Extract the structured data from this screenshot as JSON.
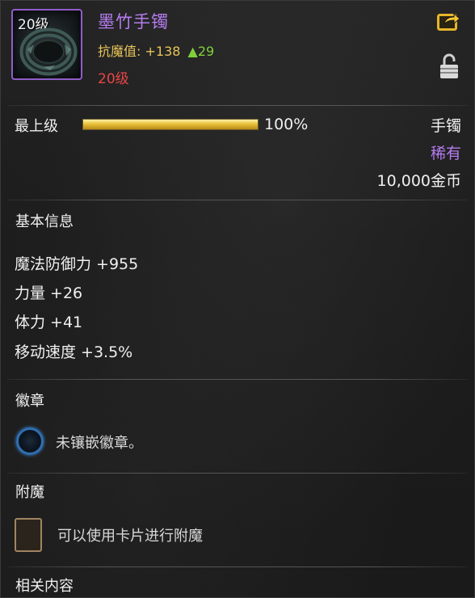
{
  "item": {
    "icon": "bracelet-icon",
    "icon_level": "20级",
    "name": "墨竹手镯",
    "stat_label": "抗魔值:",
    "stat_value": "+138",
    "stat_increase": "▲29",
    "required_level": "20级"
  },
  "header_actions": {
    "share_icon": "share-icon",
    "lock_icon": "lock-icon"
  },
  "grade": {
    "label": "最上级",
    "percent_text": "100%",
    "percent_value": 100
  },
  "meta": {
    "type": "手镯",
    "rarity": "稀有",
    "price": "10,000金币"
  },
  "basic_info": {
    "title": "基本信息",
    "attributes": [
      "魔法防御力 +955",
      "力量 +26",
      "体力 +41",
      "移动速度 +3.5%"
    ]
  },
  "emblem": {
    "title": "徽章",
    "text": "未镶嵌徽章。"
  },
  "enchant": {
    "title": "附魔",
    "text": "可以使用卡片进行附魔"
  },
  "related": {
    "title": "相关内容"
  },
  "colors": {
    "rarity_purple": "#b57cf0",
    "stat_gold": "#e7c45a",
    "increase_green": "#7fd13b",
    "level_red": "#e84545"
  }
}
